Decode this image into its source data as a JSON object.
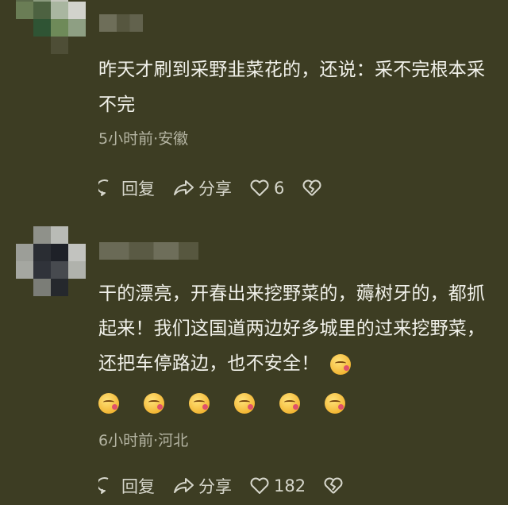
{
  "comments": [
    {
      "text": "昨天才刷到采野韭菜花的，还说：采不完根本采不完",
      "meta": "5小时前·安徽",
      "actions": {
        "reply": "回复",
        "share": "分享",
        "likes": "6"
      }
    },
    {
      "text": "干的漂亮，开春出来挖野菜的，薅树牙的，都抓起来！我们这国道两边好多城里的过来挖野菜，还把车停路边，也不安全！",
      "meta": "6小时前·河北",
      "actions": {
        "reply": "回复",
        "share": "分享",
        "likes": "182"
      }
    }
  ]
}
